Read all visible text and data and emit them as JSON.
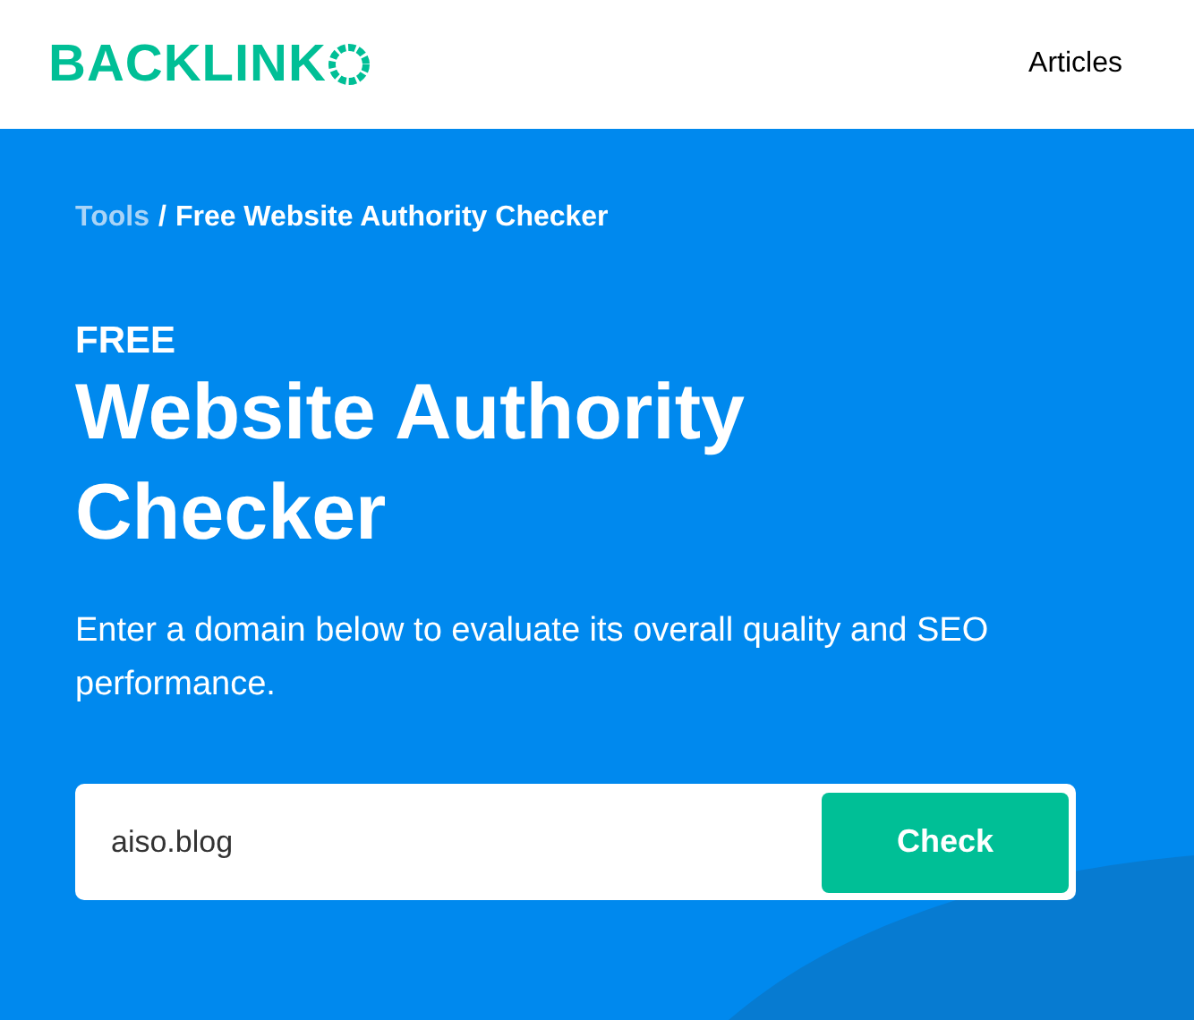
{
  "header": {
    "logo": "BACKLINK",
    "nav": [
      "Articles"
    ]
  },
  "breadcrumb": {
    "link": "Tools",
    "separator": "/",
    "current": "Free Website Authority Checker"
  },
  "eyebrow": "FREE",
  "title": "Website Authority Checker",
  "description": "Enter a domain below to evaluate its overall quality and SEO performance.",
  "search": {
    "value": "aiso.blog",
    "button": "Check"
  }
}
